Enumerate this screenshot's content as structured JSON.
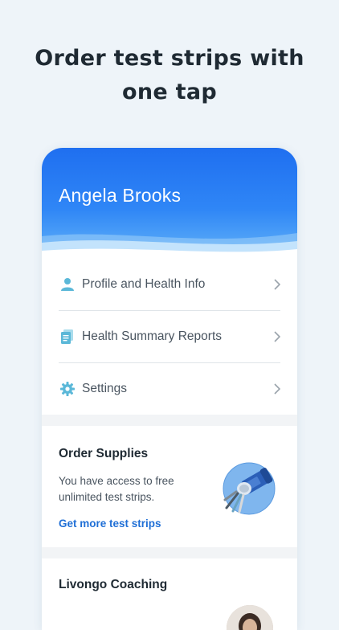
{
  "headline": {
    "line1": "Order test strips with",
    "line2": "one tap"
  },
  "profile": {
    "name": "Angela Brooks"
  },
  "menu": {
    "items": [
      {
        "label": "Profile and Health Info",
        "icon": "person-icon"
      },
      {
        "label": "Health Summary Reports",
        "icon": "document-icon"
      },
      {
        "label": "Settings",
        "icon": "gear-icon"
      }
    ]
  },
  "supplies": {
    "title": "Order Supplies",
    "text": "You have access to free unlimited test strips.",
    "link": "Get more test strips"
  },
  "coaching": {
    "title": "Livongo Coaching"
  },
  "colors": {
    "accent": "#1f6ff0",
    "link": "#1f6fd6",
    "icon": "#5bb8d8",
    "background": "#eef4f9"
  }
}
